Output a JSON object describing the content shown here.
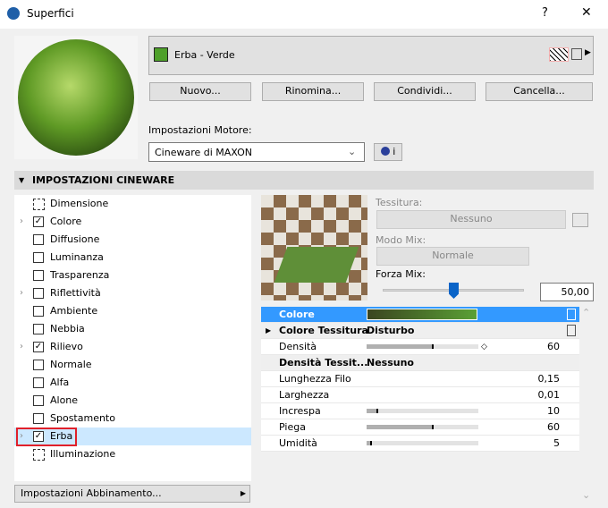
{
  "window": {
    "title": "Superfici",
    "help": "?",
    "close": "✕"
  },
  "material": {
    "name": "Erba - Verde",
    "swatch": "#4ea02a"
  },
  "buttons": {
    "new": "Nuovo...",
    "rename": "Rinomina...",
    "share": "Condividi...",
    "delete": "Cancella..."
  },
  "engine": {
    "label": "Impostazioni Motore:",
    "value": "Cineware di MAXON",
    "info": "i"
  },
  "section": {
    "title": "IMPOSTAZIONI CINEWARE"
  },
  "channels": [
    {
      "label": "Dimensione",
      "type": "icon"
    },
    {
      "label": "Colore",
      "checked": true,
      "expand": true
    },
    {
      "label": "Diffusione",
      "checked": false
    },
    {
      "label": "Luminanza",
      "checked": false
    },
    {
      "label": "Trasparenza",
      "checked": false
    },
    {
      "label": "Riflettività",
      "checked": false,
      "expand": true
    },
    {
      "label": "Ambiente",
      "checked": false
    },
    {
      "label": "Nebbia",
      "checked": false
    },
    {
      "label": "Rilievo",
      "checked": true,
      "expand": true
    },
    {
      "label": "Normale",
      "checked": false
    },
    {
      "label": "Alfa",
      "checked": false
    },
    {
      "label": "Alone",
      "checked": false
    },
    {
      "label": "Spostamento",
      "checked": false
    },
    {
      "label": "Erba",
      "checked": true,
      "expand": true,
      "selected": true
    },
    {
      "label": "Illuminazione",
      "type": "icon"
    }
  ],
  "matching": {
    "label": "Impostazioni Abbinamento..."
  },
  "texture": {
    "label": "Tessitura:",
    "value": "Nessuno",
    "mix_mode_label": "Modo Mix:",
    "mix_mode": "Normale",
    "mix_strength_label": "Forza Mix:",
    "mix_strength": "50,00",
    "mix_fraction": 0.5
  },
  "properties": [
    {
      "name": "Colore",
      "selected": true,
      "gradient": [
        "#3b4520",
        "#5aa035"
      ]
    },
    {
      "name": "Colore Tessitura",
      "value": "Disturbo",
      "bold": true
    },
    {
      "name": "Densità",
      "number": "60",
      "slider": 60
    },
    {
      "name": "Densità Tessit...",
      "value": "Nessuno",
      "bold": true
    },
    {
      "name": "Lunghezza Filo",
      "number": "0,15"
    },
    {
      "name": "Larghezza",
      "number": "0,01"
    },
    {
      "name": "Increspa",
      "number": "10",
      "slider": 10
    },
    {
      "name": "Piega",
      "number": "60",
      "slider": 60
    },
    {
      "name": "Umidità",
      "number": "5",
      "slider": 5
    }
  ]
}
